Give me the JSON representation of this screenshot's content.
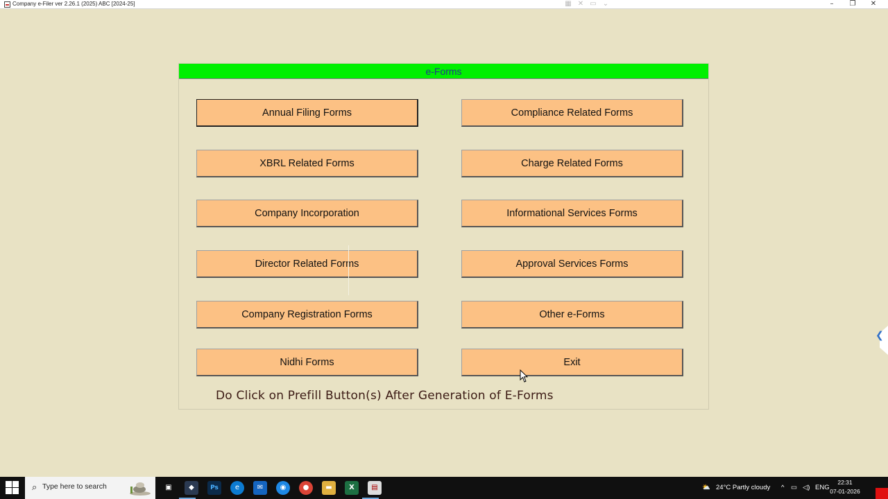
{
  "window": {
    "title": "Company e-Filer ver 2.26.1 (2025) ABC [2024-25]",
    "minimize_glyph": "–",
    "restore_glyph": "❐",
    "close_glyph": "✕"
  },
  "panel": {
    "header": "e-Forms",
    "buttons_left": [
      "Annual Filing Forms",
      "XBRL Related Forms",
      "Company Incorporation",
      "Director Related Forms",
      "Company Registration Forms",
      "Nidhi Forms"
    ],
    "buttons_right": [
      "Compliance Related Forms",
      "Charge Related Forms",
      "Informational Services Forms",
      "Approval Services Forms",
      "Other e-Forms",
      "Exit"
    ],
    "note": "Do Click on Prefill Button(s) After Generation of E-Forms"
  },
  "colors": {
    "background": "#e8e2c4",
    "header_bg": "#00f000",
    "header_text": "#1f3a8a",
    "button_bg": "#fcc184"
  },
  "taskbar": {
    "search_placeholder": "Type here to search",
    "weather": "24°C  Partly cloudy",
    "language": "ENG",
    "time": "22:31",
    "date": "07-01-2026",
    "pinned_icons": [
      "task-view-icon",
      "app-icon",
      "photoshop-icon",
      "edge-icon",
      "outlook-icon",
      "app-blue-icon",
      "chrome-icon",
      "file-explorer-icon",
      "excel-icon",
      "company-efiler-icon"
    ]
  }
}
